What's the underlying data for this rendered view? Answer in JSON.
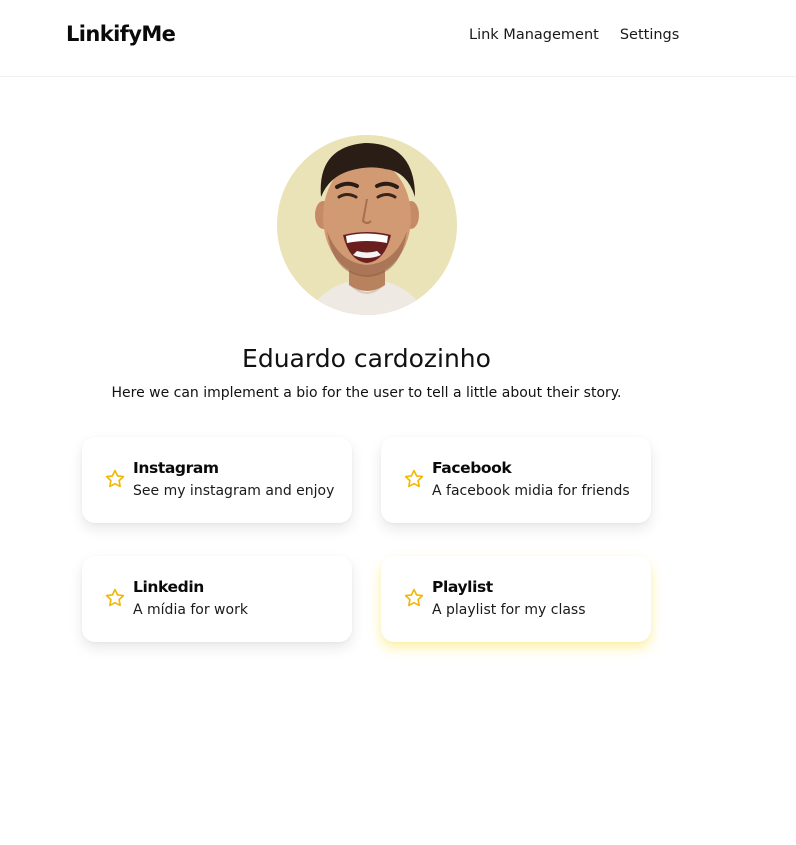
{
  "header": {
    "logo": "LinkifyMe",
    "nav": [
      "Link Management",
      "Settings"
    ]
  },
  "profile": {
    "name": "Eduardo cardozinho",
    "bio": "Here we can implement a bio for the user to tell a little about their story."
  },
  "links": [
    {
      "title": "Instagram",
      "description": "See my instagram and enjoy",
      "icon": "star-icon"
    },
    {
      "title": "Facebook",
      "description": "A facebook midia for friends",
      "icon": "star-icon"
    },
    {
      "title": "Linkedin",
      "description": "A mídia for work",
      "icon": "star-icon"
    },
    {
      "title": "Playlist",
      "description": "A playlist for my class",
      "icon": "star-icon"
    }
  ],
  "colors": {
    "accent": "#f2b705",
    "text": "#111111",
    "avatar_bg": "#ebe3b8"
  }
}
